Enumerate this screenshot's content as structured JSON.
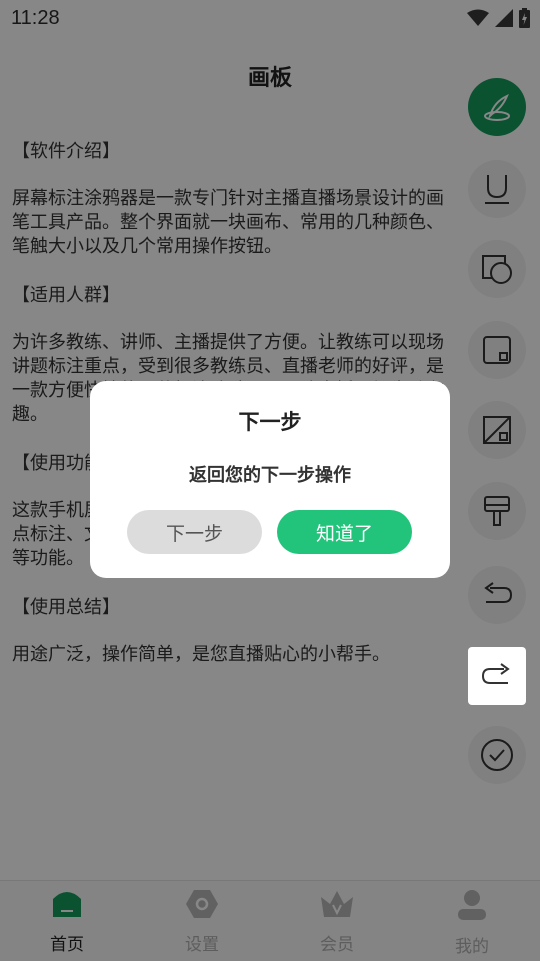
{
  "status": {
    "time": "11:28"
  },
  "page": {
    "title": "画板"
  },
  "content": {
    "sections": [
      {
        "title": "【软件介绍】",
        "text": "屏幕标注涂鸦器是一款专门针对主播直播场景设计的画笔工具产品。整个界面就一块画布、常用的几种颜色、笔触大小以及几个常用操作按钮。"
      },
      {
        "title": "【适用人群】",
        "text": "为许多教练、讲师、主播提供了方便。让教练可以现场讲题标注重点，受到很多教练员、直播老师的好评，是一款方便快捷的屏幕标注涂鸦工具，让直播更加生动有趣。"
      },
      {
        "title": "【使用功能】",
        "text": "这款手机屏幕标注工具可以在屏幕上随意绘画，进行重点标注、文字标注、形状标注等，并且支持悬浮窗使用等功能。"
      },
      {
        "title": "【使用总结】",
        "text": "用途广泛，操作简单，是您直播贴心的小帮手。"
      }
    ]
  },
  "toolbar": {
    "tools": [
      "pen-icon",
      "underline-icon",
      "shape-icon",
      "square-icon",
      "eraser-icon",
      "brush-icon",
      "undo-icon",
      "redo-icon",
      "check-icon"
    ]
  },
  "tabs": [
    {
      "label": "首页",
      "icon": "home-icon"
    },
    {
      "label": "设置",
      "icon": "settings-icon"
    },
    {
      "label": "会员",
      "icon": "crown-icon"
    },
    {
      "label": "我的",
      "icon": "user-icon"
    }
  ],
  "dialog": {
    "title": "下一步",
    "message": "返回您的下一步操作",
    "next_label": "下一步",
    "ok_label": "知道了"
  },
  "colors": {
    "accent": "#22c37a",
    "brand_dark": "#169b5e"
  }
}
